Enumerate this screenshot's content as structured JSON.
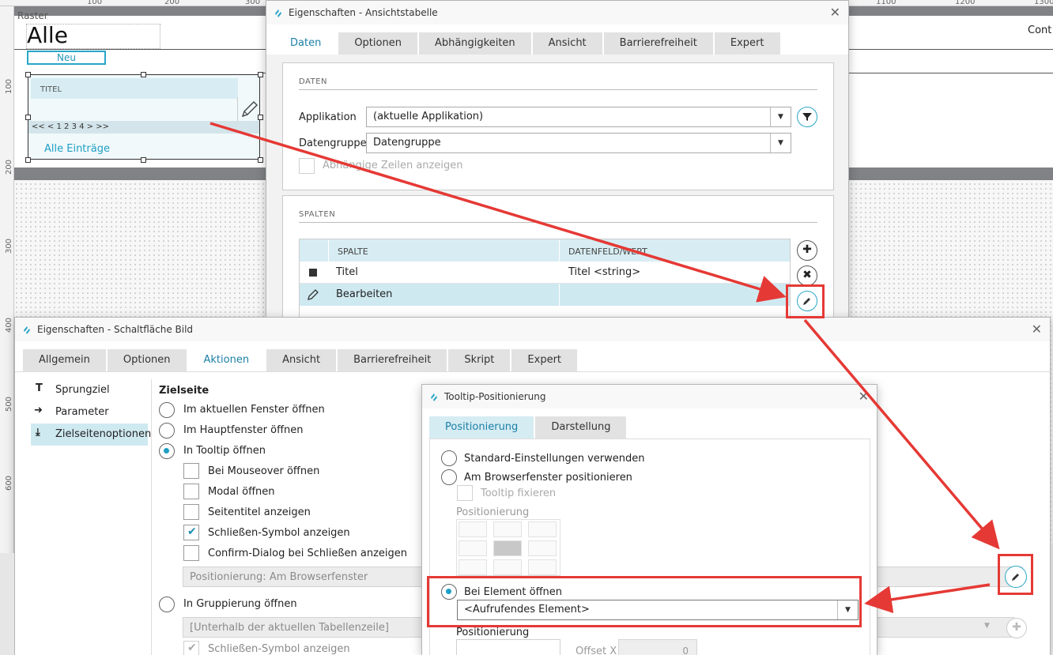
{
  "designer": {
    "raster_label": "Raster",
    "page_heading": "Alle",
    "new_button": "Neu",
    "cont_label": "Cont",
    "ruler_top": [
      "100",
      "200",
      "300",
      "1100",
      "1200",
      "1300"
    ],
    "ruler_left": [
      "100",
      "200",
      "300",
      "400",
      "500",
      "600"
    ],
    "widget": {
      "header": "TITEL",
      "pager": "<< <  1  2  3  4  > >>",
      "link": "Alle Einträge"
    }
  },
  "dialog1": {
    "title": "Eigenschaften - Ansichtstabelle",
    "tabs": [
      "Daten",
      "Optionen",
      "Abhängigkeiten",
      "Ansicht",
      "Barrierefreiheit",
      "Expert"
    ],
    "daten_section": "DATEN",
    "applikation_label": "Applikation",
    "applikation_value": "(aktuelle Applikation)",
    "datengruppe_label": "Datengruppe",
    "datengruppe_value": "Datengruppe",
    "abhaengige_label": "Abhängige Zeilen anzeigen",
    "spalten_section": "SPALTEN",
    "col_headers": [
      "SPALTE",
      "DATENFELD/WERT"
    ],
    "rows": [
      {
        "spalte": "Titel",
        "wert": "Titel <string>"
      },
      {
        "spalte": "Bearbeiten",
        "wert": ""
      }
    ]
  },
  "dialog2": {
    "title": "Eigenschaften - Schaltfläche Bild",
    "tabs": [
      "Allgemein",
      "Optionen",
      "Aktionen",
      "Ansicht",
      "Barrierefreiheit",
      "Skript",
      "Expert"
    ],
    "side_items": [
      "Sprungziel",
      "Parameter",
      "Zielseitenoptionen"
    ],
    "zielseite_heading": "Zielseite",
    "options": {
      "aktuelles_fenster": "Im aktuellen Fenster öffnen",
      "hauptfenster": "Im Hauptfenster öffnen",
      "tooltip": "In Tooltip öffnen",
      "mouseover": "Bei Mouseover öffnen",
      "modal": "Modal öffnen",
      "seitentitel": "Seitentitel anzeigen",
      "schliessen": "Schließen-Symbol anzeigen",
      "confirm": "Confirm-Dialog bei Schließen anzeigen",
      "positionierung_value": "Positionierung: Am Browserfenster",
      "gruppierung": "In Gruppierung öffnen",
      "unterhalb": "[Unterhalb der aktuellen Tabellenzeile]",
      "schliessen2": "Schließen-Symbol anzeigen"
    }
  },
  "dialog3": {
    "title": "Tooltip-Positionierung",
    "tabs": [
      "Positionierung",
      "Darstellung"
    ],
    "standard": "Standard-Einstellungen verwenden",
    "browserfenster": "Am Browserfenster positionieren",
    "fixieren": "Tooltip fixieren",
    "positionierung_label": "Positionierung",
    "bei_element": "Bei Element öffnen",
    "element_value": "<Aufrufendes Element>",
    "positionierung_label2": "Positionierung",
    "offset_x_label": "Offset X",
    "offset_x_value": "0"
  },
  "colors": {
    "accent": "#1e9fc4",
    "highlight": "#e53935",
    "tab_active_bg": "#d6ecf3"
  }
}
